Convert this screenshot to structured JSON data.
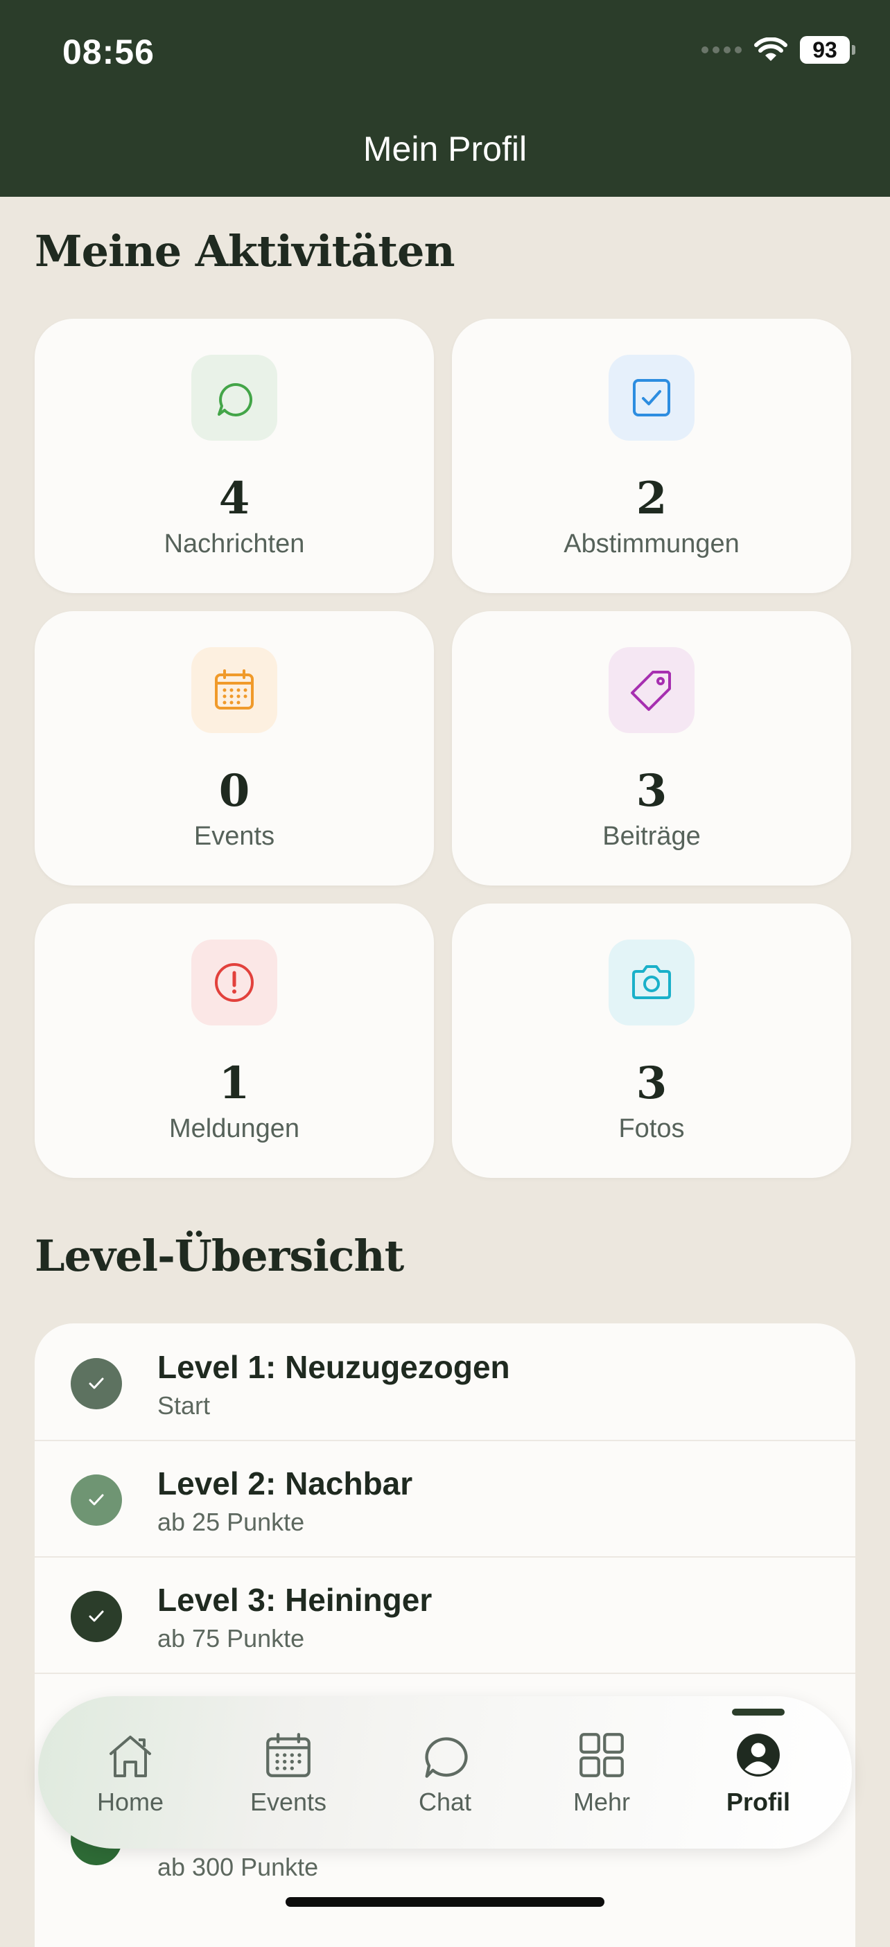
{
  "status_bar": {
    "time": "08:56",
    "battery": "93"
  },
  "header": {
    "title": "Mein Profil"
  },
  "activities": {
    "title": "Meine Aktivitäten",
    "items": [
      {
        "count": "4",
        "label": "Nachrichten",
        "icon": "chat-bubble-icon",
        "color": "#43a548",
        "bg": "#e9f2e8"
      },
      {
        "count": "2",
        "label": "Abstimmungen",
        "icon": "checkbox-icon",
        "color": "#2d8de0",
        "bg": "#e6f0fb"
      },
      {
        "count": "0",
        "label": "Events",
        "icon": "calendar-icon",
        "color": "#f09a2a",
        "bg": "#fdf0e0"
      },
      {
        "count": "3",
        "label": "Beiträge",
        "icon": "tag-icon",
        "color": "#a62fb0",
        "bg": "#f5e7f3"
      },
      {
        "count": "1",
        "label": "Meldungen",
        "icon": "alert-circle-icon",
        "color": "#e2413c",
        "bg": "#fbe7e6"
      },
      {
        "count": "3",
        "label": "Fotos",
        "icon": "camera-icon",
        "color": "#1ab0c9",
        "bg": "#e3f4f7"
      }
    ]
  },
  "levels": {
    "title": "Level-Übersicht",
    "items": [
      {
        "title": "Level 1: Neuzugezogen",
        "subtitle": "Start",
        "color": "#5d7260"
      },
      {
        "title": "Level 2: Nachbar",
        "subtitle": "ab 25 Punkte",
        "color": "#6f9573"
      },
      {
        "title": "Level 3: Heininger",
        "subtitle": "ab 75 Punkte",
        "color": "#2b3d2a"
      },
      {
        "title": "",
        "subtitle": "ab 300 Punkte",
        "color": "#2e6b36"
      }
    ]
  },
  "tabbar": {
    "items": [
      {
        "label": "Home",
        "icon": "home-icon"
      },
      {
        "label": "Events",
        "icon": "calendar-icon"
      },
      {
        "label": "Chat",
        "icon": "chat-bubble-icon"
      },
      {
        "label": "Mehr",
        "icon": "grid-icon"
      },
      {
        "label": "Profil",
        "icon": "profile-icon",
        "active": true
      }
    ]
  }
}
